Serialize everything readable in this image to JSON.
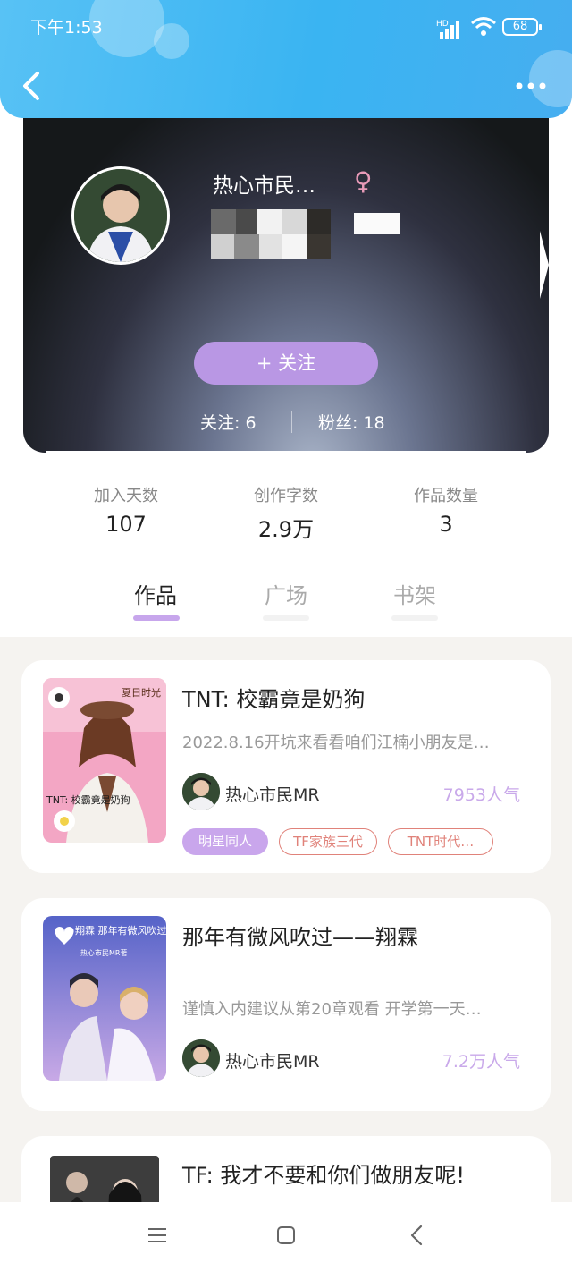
{
  "status_bar": {
    "time": "下午1:53",
    "network": "HD",
    "battery": "68"
  },
  "profile": {
    "nickname": "热心市民…",
    "gender_symbol": "♀",
    "follow_button": "+ 关注",
    "following_label": "关注: 6",
    "followers_label": "粉丝: 18"
  },
  "stats": [
    {
      "label": "加入天数",
      "value": "107"
    },
    {
      "label": "创作字数",
      "value": "2.9万"
    },
    {
      "label": "作品数量",
      "value": "3"
    }
  ],
  "tabs": [
    {
      "label": "作品",
      "active": true
    },
    {
      "label": "广场",
      "active": false
    },
    {
      "label": "书架",
      "active": false
    }
  ],
  "works": [
    {
      "title": "TNT: 校霸竟是奶狗",
      "description": "2022.8.16开坑来看看咱们江楠小朋友是…",
      "author": "热心市民MR",
      "popularity": "7953人气",
      "tags": [
        "明星同人",
        "TF家族三代",
        "TNT时代…"
      ],
      "cover_text": "夏日时光",
      "cover_caption": "TNT: 校霸竟是奶狗"
    },
    {
      "title": "那年有微风吹过——翔霖",
      "description": "谨慎入内建议从第20章观看 开学第一天…",
      "author": "热心市民MR",
      "popularity": "7.2万人气",
      "tags": [],
      "cover_text": "翔霖 那年有微风吹过",
      "cover_caption": "热心市民MR著"
    },
    {
      "title": "TF: 我才不要和你们做朋友呢!",
      "description": "",
      "author": "",
      "popularity": "",
      "tags": []
    }
  ],
  "colors": {
    "accent": "#b997e4",
    "header": "#3ab4f2",
    "tag_outline": "#e0827a",
    "popularity": "#c9a9ea"
  }
}
